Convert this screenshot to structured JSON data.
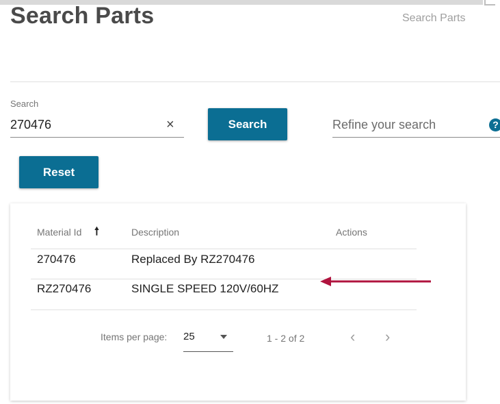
{
  "header": {
    "title": "Search Parts",
    "breadcrumb": "Search Parts"
  },
  "search": {
    "label": "Search",
    "value": "270476",
    "clear_glyph": "×",
    "button_label": "Search",
    "reset_label": "Reset"
  },
  "refine": {
    "placeholder": "Refine your search",
    "help_glyph": "?"
  },
  "table": {
    "columns": [
      "Material Id",
      "Description",
      "Actions"
    ],
    "sort_glyph": "🠕",
    "rows": [
      {
        "material_id": "270476",
        "description": "Replaced By RZ270476"
      },
      {
        "material_id": "RZ270476",
        "description": "SINGLE SPEED 120V/60HZ"
      }
    ]
  },
  "pagination": {
    "items_per_page_label": "Items per page:",
    "items_per_page_value": "25",
    "range": "1 - 2 of 2",
    "prev_glyph": "‹",
    "next_glyph": "›"
  },
  "annotation": {
    "arrow_color": "#b0133e"
  },
  "colors": {
    "accent": "#0b6e93"
  },
  "icons": [
    "close-icon",
    "help-icon",
    "sort-up-icon",
    "chevron-down-icon",
    "chevron-left-icon",
    "chevron-right-icon"
  ]
}
